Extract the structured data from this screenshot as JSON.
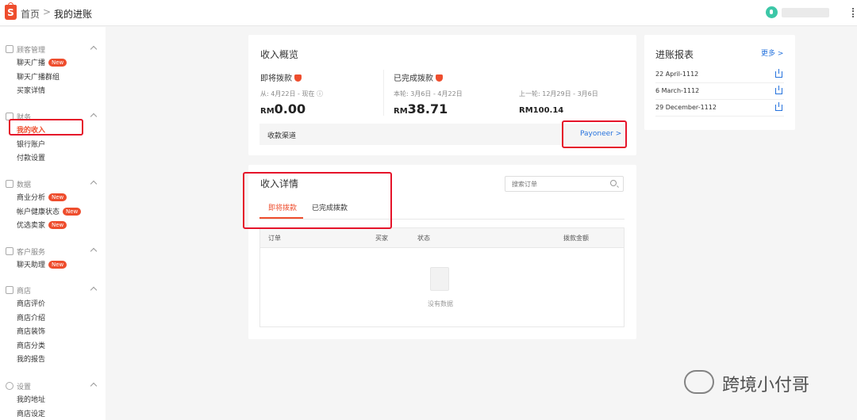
{
  "header": {
    "logo_letter": "S",
    "breadcrumb_home": "首页",
    "breadcrumb_sep": ">",
    "breadcrumb_current": "我的进账"
  },
  "sidebar": {
    "groups": [
      {
        "title": "顾客管理",
        "icon": "users-icon",
        "items": [
          {
            "label": "聊天广播",
            "badge": "New"
          },
          {
            "label": "聊天广播群组"
          },
          {
            "label": "买家详情"
          }
        ]
      },
      {
        "title": "财务",
        "icon": "wallet-icon",
        "items": [
          {
            "label": "我的收入",
            "active": true
          },
          {
            "label": "银行账户"
          },
          {
            "label": "付款设置"
          }
        ]
      },
      {
        "title": "数据",
        "icon": "chart-icon",
        "items": [
          {
            "label": "商业分析",
            "badge": "New"
          },
          {
            "label": "帐户健康状态",
            "badge": "New"
          },
          {
            "label": "优选卖家",
            "badge": "New"
          }
        ]
      },
      {
        "title": "客户服务",
        "icon": "chat-icon",
        "items": [
          {
            "label": "聊天助理",
            "badge": "New"
          }
        ]
      },
      {
        "title": "商店",
        "icon": "store-icon",
        "items": [
          {
            "label": "商店评价"
          },
          {
            "label": "商店介绍"
          },
          {
            "label": "商店装饰"
          },
          {
            "label": "商店分类"
          },
          {
            "label": "我的报告"
          }
        ]
      },
      {
        "title": "设置",
        "icon": "gear-icon",
        "items": [
          {
            "label": "我的地址"
          },
          {
            "label": "商店设定"
          }
        ]
      }
    ]
  },
  "overview": {
    "title": "收入概览",
    "upcoming_label": "即将拨款",
    "upcoming_range": "从: 4月22日 - 现在 ⓘ",
    "upcoming_currency": "RM",
    "upcoming_amount": "0.00",
    "completed_label": "已完成拨款",
    "completed_range": "本轮: 3月6日 - 4月22日",
    "completed_currency": "RM",
    "completed_amount": "38.71",
    "previous_range": "上一轮: 12月29日 - 3月6日",
    "previous_amount": "RM100.14",
    "channel_label": "收款渠道",
    "channel_value": "Payoneer >"
  },
  "details": {
    "title": "收入详情",
    "search_placeholder": "搜索订单",
    "tabs": [
      "即将拨款",
      "已完成拨款"
    ],
    "columns": [
      "订单",
      "买家",
      "状态",
      "拨款金额"
    ],
    "empty_text": "没有数据"
  },
  "reports": {
    "title": "进账报表",
    "more": "更多 >",
    "rows": [
      "22 April-1112",
      "6 March-1112",
      "29 December-1112"
    ]
  },
  "watermark": "跨境小付哥",
  "colors": {
    "brand": "#ee4d2d",
    "link": "#2673dd",
    "highlight_box": "#e5142a"
  }
}
